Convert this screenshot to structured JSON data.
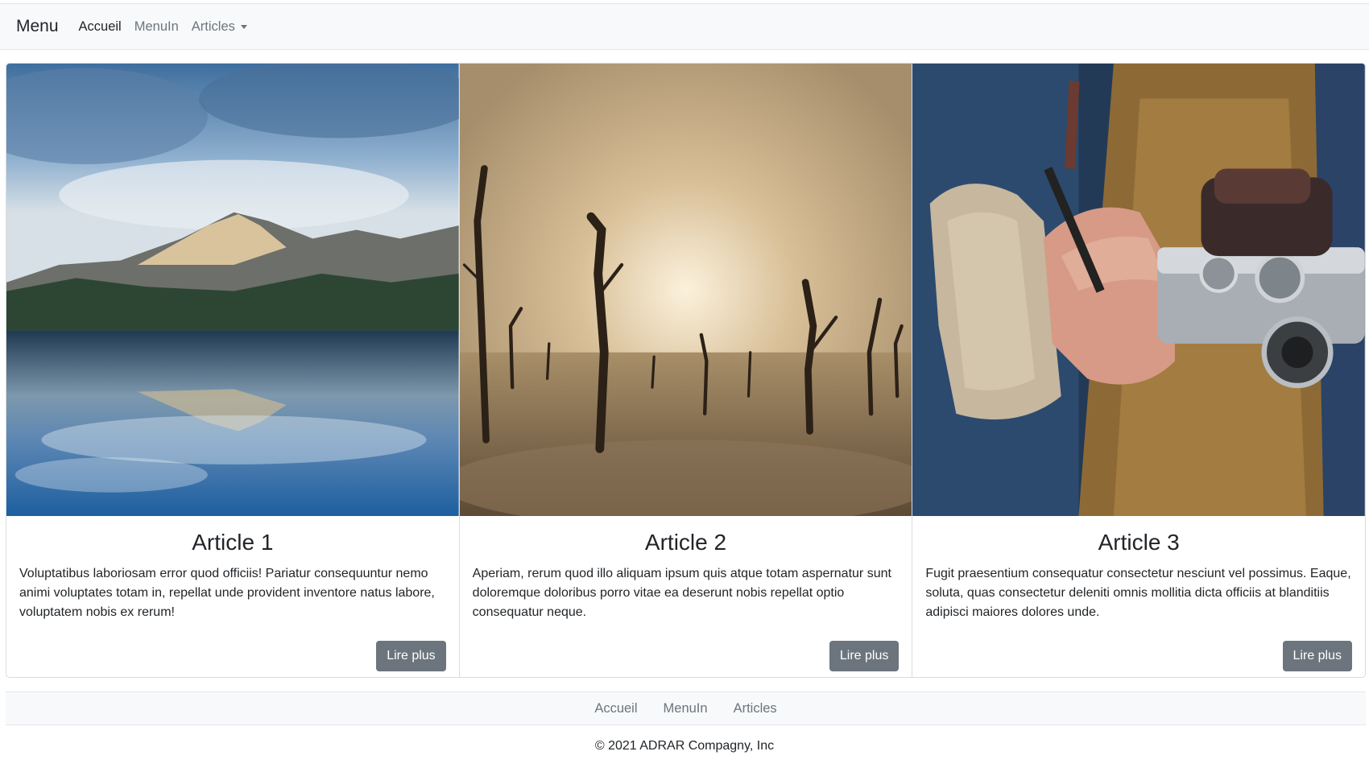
{
  "navbar": {
    "brand": "Menu",
    "links": [
      {
        "label": "Accueil",
        "active": true
      },
      {
        "label": "MenuIn",
        "active": false
      },
      {
        "label": "Articles",
        "active": false,
        "dropdown": true
      }
    ]
  },
  "articles": [
    {
      "title": "Article 1",
      "text": "Voluptatibus laboriosam error quod officiis! Pariatur consequuntur nemo animi voluptates totam in, repellat unde provident inventore natus labore, voluptatem nobis ex rerum!",
      "button": "Lire plus",
      "image": "mountain-lake-photo"
    },
    {
      "title": "Article 2",
      "text": "Aperiam, rerum quod illo aliquam ipsum quis atque totam aspernatur sunt doloremque doloribus porro vitae ea deserunt nobis repellat optio consequatur neque.",
      "button": "Lire plus",
      "image": "dead-trees-fog-photo"
    },
    {
      "title": "Article 3",
      "text": "Fugit praesentium consequatur consectetur nesciunt vel possimus. Eaque, soluta, quas consectetur deleniti omnis mollitia dicta officiis at blanditiis adipisci maiores dolores unde.",
      "button": "Lire plus",
      "image": "hand-holding-camera-photo"
    }
  ],
  "footer": {
    "links": [
      "Accueil",
      "MenuIn",
      "Articles"
    ],
    "copyright": "© 2021 ADRAR Compagny, Inc"
  },
  "colors": {
    "navbar_bg": "#f8f9fa",
    "button_bg": "#6c757d",
    "muted_text": "#6c757d"
  }
}
